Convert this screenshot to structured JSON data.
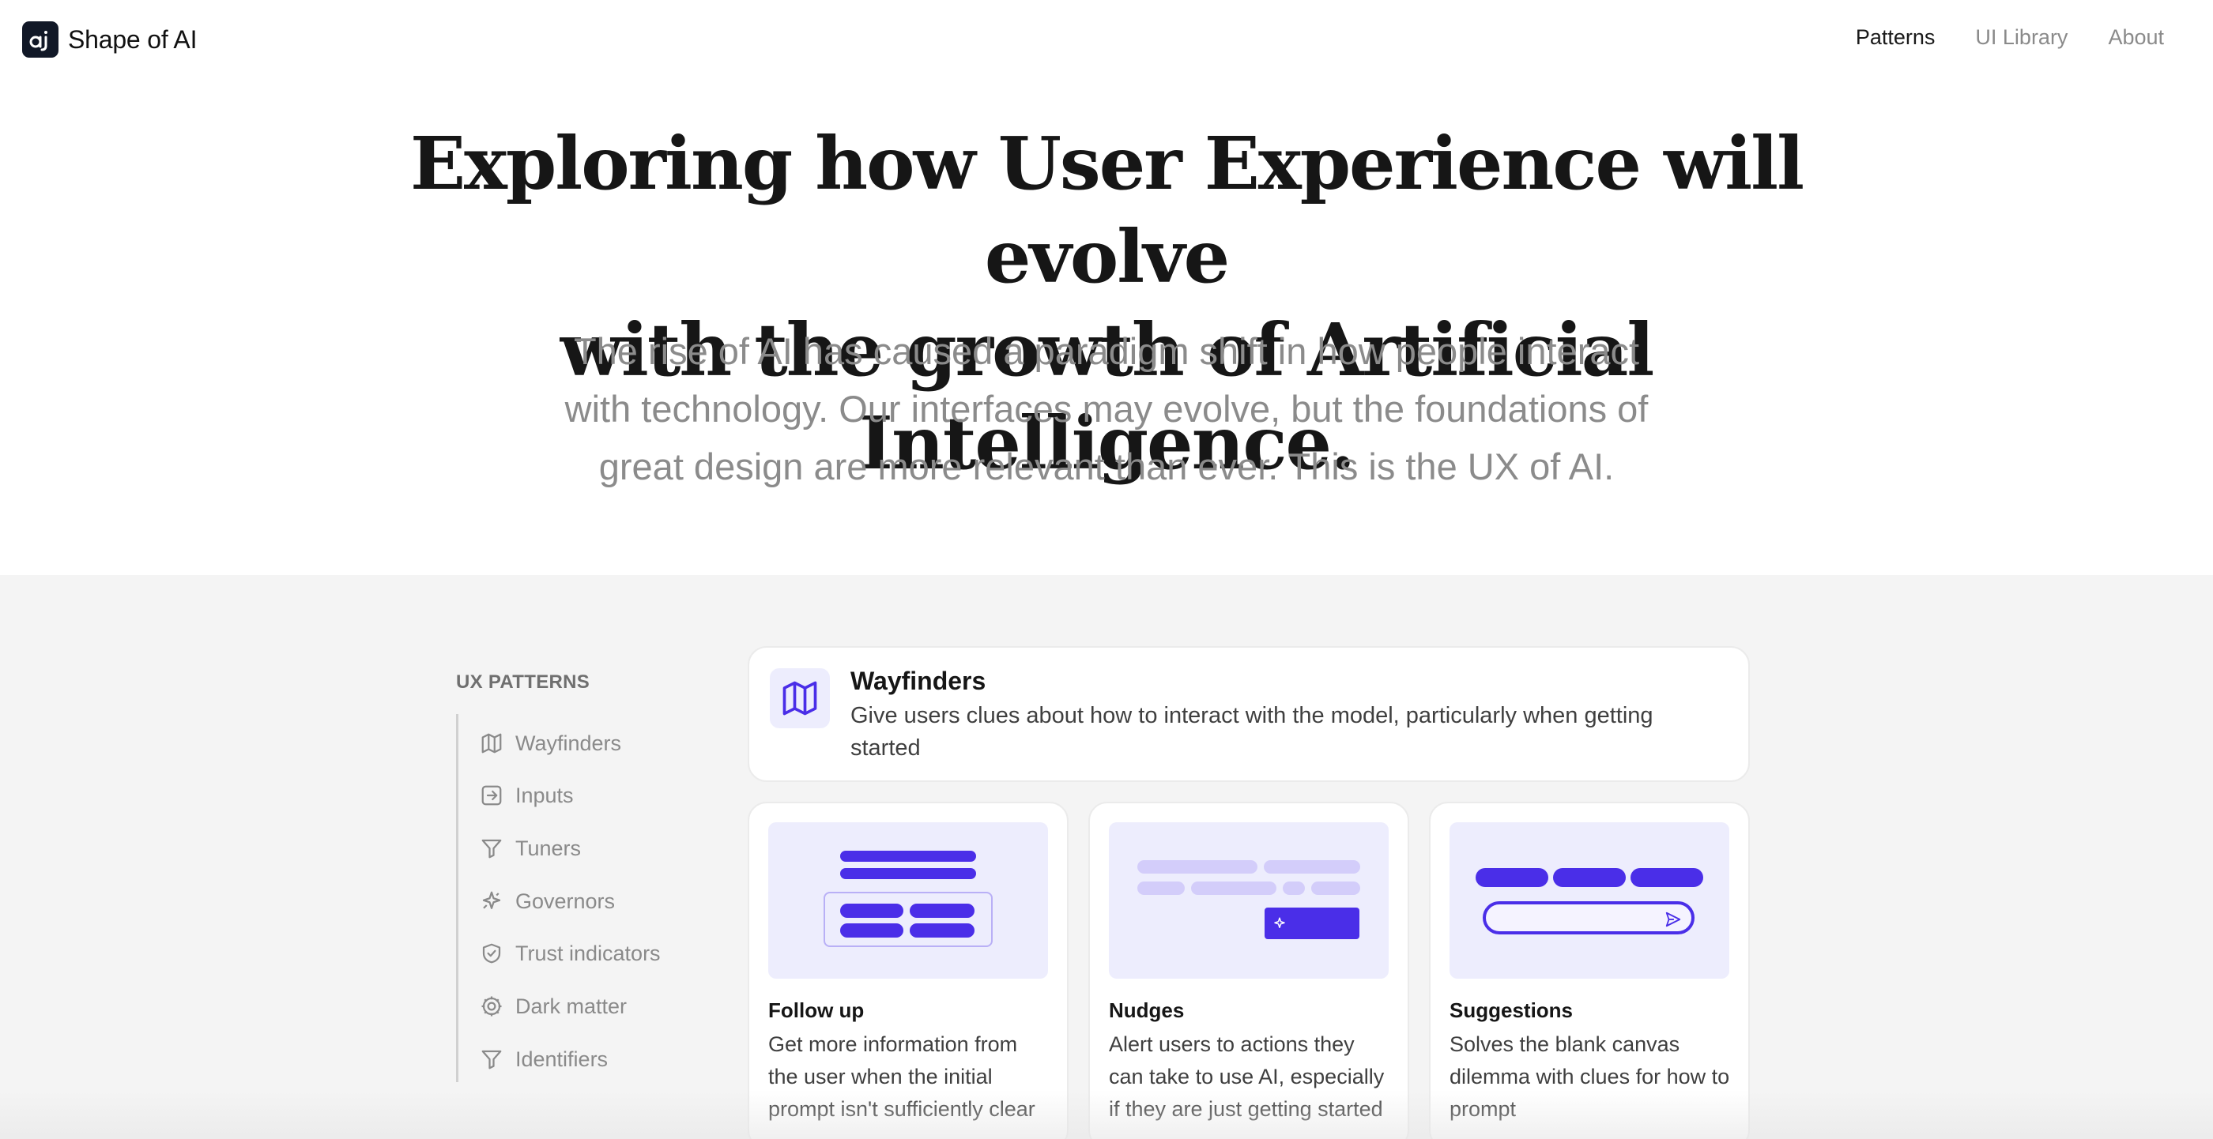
{
  "brand": {
    "logo_glyph": "aj",
    "name": "Shape of AI"
  },
  "nav": {
    "items": [
      {
        "label": "Patterns",
        "active": true
      },
      {
        "label": "UI Library",
        "active": false
      },
      {
        "label": "About",
        "active": false
      }
    ]
  },
  "hero": {
    "title_line1": "Exploring how User Experience will evolve",
    "title_line2": "with the growth of Artificial Intelligence.",
    "subtitle_line1": "The rise of AI has caused a paradigm shift in how people interact",
    "subtitle_line2": "with technology. Our interfaces may evolve, but the foundations of",
    "subtitle_line3": "great design are more relevant than ever. This is the UX of AI."
  },
  "sidebar": {
    "title": "UX PATTERNS",
    "items": [
      {
        "label": "Wayfinders",
        "icon": "map-icon"
      },
      {
        "label": "Inputs",
        "icon": "arrow-into-box-icon"
      },
      {
        "label": "Tuners",
        "icon": "funnel-icon"
      },
      {
        "label": "Governors",
        "icon": "sparkle-icon"
      },
      {
        "label": "Trust indicators",
        "icon": "shield-check-icon"
      },
      {
        "label": "Dark matter",
        "icon": "cog-icon"
      },
      {
        "label": "Identifiers",
        "icon": "funnel-icon"
      }
    ]
  },
  "featured": {
    "icon": "map-icon",
    "title": "Wayfinders",
    "description": "Give users clues about how to interact with the model, particularly when getting started"
  },
  "cards": [
    {
      "title": "Follow up",
      "description": "Get more information from the user when the initial prompt isn't sufficiently clear"
    },
    {
      "title": "Nudges",
      "description": "Alert users to actions they can take to use AI, especially if they are just getting started"
    },
    {
      "title": "Suggestions",
      "description": "Solves the blank canvas dilemma with clues for how to prompt"
    }
  ],
  "colors": {
    "accent": "#4a2ee8",
    "accent_light": "#d3cdfa",
    "illustration_bg": "#ededfd",
    "section_bg": "#f4f4f4"
  }
}
